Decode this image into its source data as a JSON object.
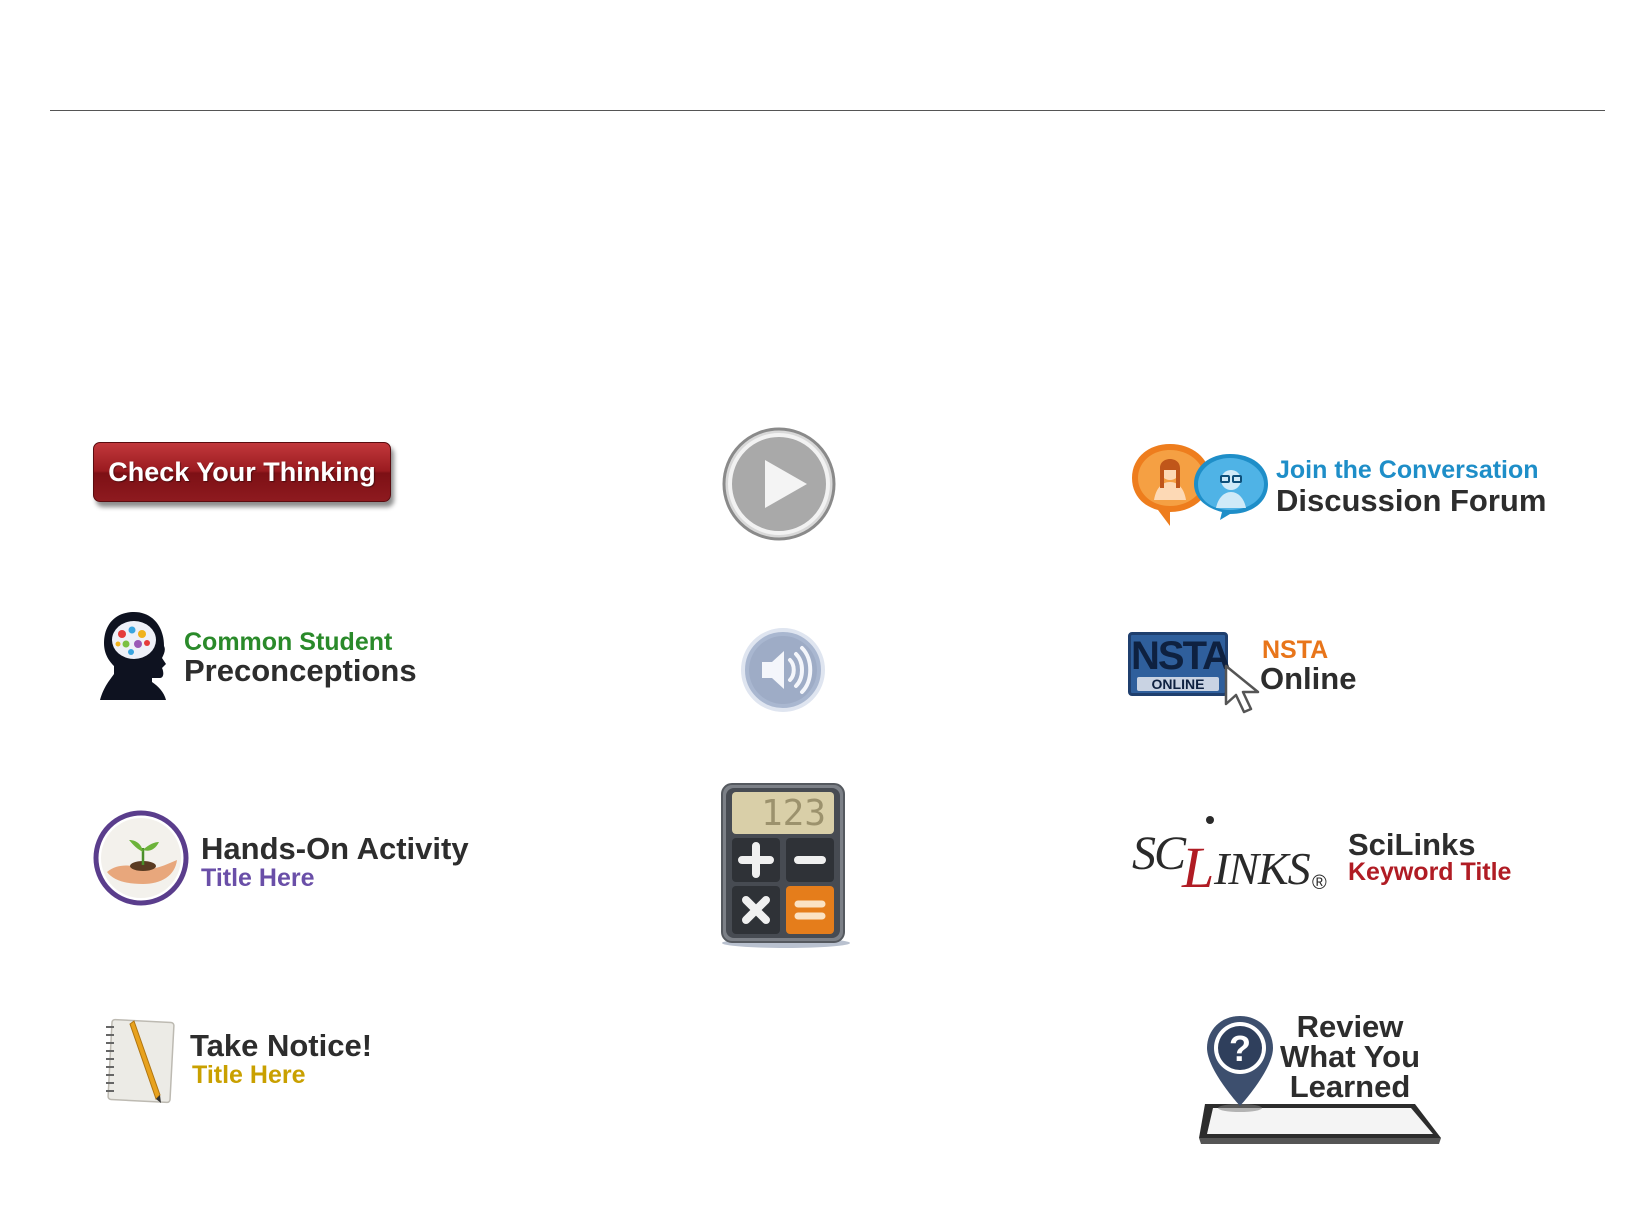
{
  "check_thinking": {
    "label": "Check Your Thinking"
  },
  "preconceptions": {
    "line1": "Common Student",
    "line2": "Preconceptions"
  },
  "hands_on": {
    "line1": "Hands-On Activity",
    "line2": "Title Here"
  },
  "take_notice": {
    "line1": "Take Notice!",
    "line2": "Title Here"
  },
  "calculator": {
    "display": "123"
  },
  "discussion": {
    "line1": "Join the Conversation",
    "line2": "Discussion Forum"
  },
  "nsta": {
    "logo_top": "NSTA",
    "logo_bottom": "ONLINE",
    "line1": "NSTA",
    "line2": "Online"
  },
  "scilinks": {
    "logo_left": "SC",
    "logo_mid": "L",
    "logo_right": "INKS",
    "registered": "®",
    "line1": "SciLinks",
    "line2": "Keyword Title"
  },
  "review": {
    "line1": "Review",
    "line2": "What You",
    "line3": "Learned",
    "pin_symbol": "?"
  },
  "colors": {
    "button_red": "#9a1b20",
    "green": "#2a8a2a",
    "purple": "#6a4fa8",
    "gold": "#c9a000",
    "blue_link": "#1e8ec8",
    "orange": "#e8751a",
    "sci_red": "#b01c24"
  }
}
